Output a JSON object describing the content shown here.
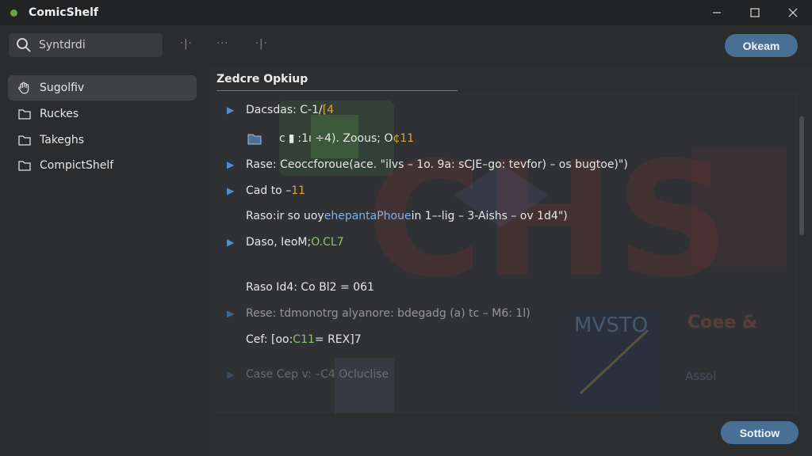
{
  "window": {
    "title": "ComicShelf",
    "controls": [
      "minimize",
      "maximize",
      "close"
    ]
  },
  "toolbar": {
    "search_placeholder": "Syntdrdi",
    "icon_a": "·|·",
    "icon_b": "···",
    "icon_c": "·|·",
    "primary_button": "Okeam"
  },
  "sidebar": {
    "items": [
      {
        "label": "Sugolfiv",
        "icon": "hand-icon",
        "active": true
      },
      {
        "label": "Ruckes",
        "icon": "folder-icon",
        "active": false
      },
      {
        "label": "Takeghs",
        "icon": "folder-icon",
        "active": false
      },
      {
        "label": "CompictShelf",
        "icon": "folder-icon",
        "active": false
      }
    ]
  },
  "main": {
    "section_title": "Zedcre Opkiup",
    "lines": [
      {
        "a": "Dacsdas: C-1/",
        "b": "[4"
      },
      {
        "a": "c  ",
        "b": ":1ı  ÷4). Zoous;  O",
        "c": "¢11"
      },
      {
        "a": "Rase: Ceoccforoue(ace. \"ilvs – 1o. 9a: sCJE–go: tevfor) – os bugtoe)\")"
      },
      {
        "a": "Cad  to –",
        "b": "11"
      },
      {
        "a": "Raso: ",
        "b": "ir so uoy ",
        "c": "ehepantaPhoue",
        "d": "  in 1–-lig – 3-Aishs  – ov 1d4\")"
      },
      {
        "a": "Daso, IeoM;   ",
        "b": "O.CL7"
      },
      {
        "a": "Raso Id4: Co  Bl2 = 061"
      },
      {
        "a": "Rese: tdmonotrg alyanore: bdegadg (a) tc – M6: 1l)"
      },
      {
        "a": "Cef: [oo:",
        "b": "C11",
        "c": " = REX]7"
      },
      {
        "a": "Case Cep v: –C4 Ocluclise"
      }
    ],
    "art_text": [
      "MVSTO",
      "Coee &",
      "Assoi"
    ],
    "secondary_button": "Sottiow"
  },
  "colors": {
    "accent_button": "#4a6f95",
    "tree_arrow": "#4d8fd6",
    "number": "#d9a63a",
    "green_text": "#8fc26c",
    "blue_text": "#7fb3ea",
    "status_dot": "#6ea338"
  }
}
